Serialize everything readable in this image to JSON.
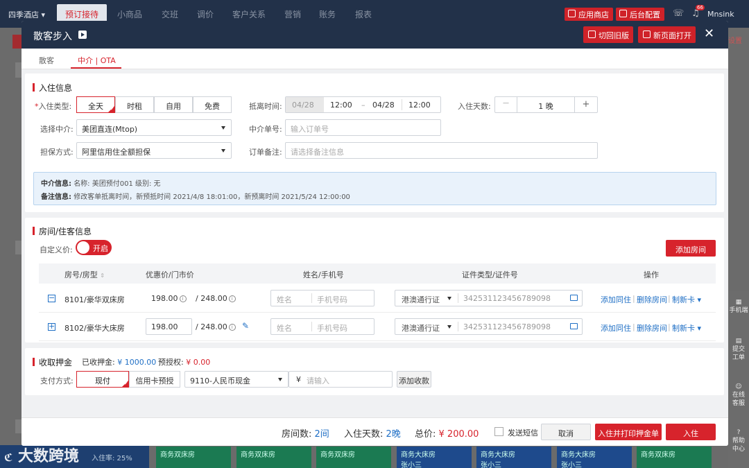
{
  "topbar": {
    "hotel": "四季酒店",
    "nav": [
      "预订接待",
      "小商品",
      "交班",
      "调价",
      "客户关系",
      "营销",
      "账务",
      "报表"
    ],
    "app_store": "应用商店",
    "admin": "后台配置",
    "badge": "66",
    "user": "Mnsink"
  },
  "background": {
    "settings": "设置",
    "occupancy": "入住率: 25%",
    "tiles": [
      "商务双床房",
      "商务双床房",
      "商务双床房",
      "商务大床房",
      "商务大床房",
      "商务大床房",
      "商务双床房"
    ],
    "tile_guests": [
      "",
      "",
      "",
      "张小三",
      "张小三",
      "张小三",
      ""
    ],
    "sidebar": [
      "手机端",
      "提交工单",
      "在线客服",
      "帮助中心"
    ]
  },
  "modal": {
    "title": "散客步入",
    "btn_old": "切回旧版",
    "btn_newpage": "新页面打开",
    "close": "✕",
    "tabs": [
      "散客",
      "中介 | OTA"
    ],
    "checkin": {
      "section": "入住信息",
      "type_label": "入住类型:",
      "types": [
        "全天",
        "时租",
        "自用",
        "免费"
      ],
      "time_label": "抵离时间:",
      "arrive_date": "04/28",
      "arrive_time": "12:00",
      "dash": "–",
      "leave_date": "04/28",
      "leave_time": "12:00",
      "days_label": "入住天数:",
      "days_minus": "—",
      "days_value": "1 晚",
      "days_plus": "+",
      "agent_label": "选择中介:",
      "agent_value": "美团直连(Mtop)",
      "order_label": "中介单号:",
      "order_placeholder": "输入订单号",
      "guarantee_label": "担保方式:",
      "guarantee_value": "阿里信用住全额担保",
      "remark_label": "订单备注:",
      "remark_placeholder": "请选择备注信息",
      "info_agent_key": "中介信息:",
      "info_agent_val": "名称:  美团预付001   级别:  无",
      "info_remark_key": "备注信息:",
      "info_remark_val": "修改客单抵离时间，新预抵时间 2021/4/8 18:01:00，新预离时间 2021/5/24 12:00:00"
    },
    "rooms": {
      "section": "房间/住客信息",
      "custom_price_label": "自定义价:",
      "toggle": "开启",
      "add_room": "添加房间",
      "headers": [
        "房号/房型",
        "优惠价/门市价",
        "姓名/手机号",
        "证件类型/证件号",
        "操作"
      ],
      "rows": [
        {
          "expand": "−",
          "room": "8101/豪华双床房",
          "price": "198.00",
          "rack": "/  248.00",
          "name_ph": "姓名",
          "phone_ph": "手机号码",
          "id_type": "港澳通行证",
          "id_no": "342531123456789098",
          "act_add": "添加同住",
          "act_del": "删除房间",
          "act_card": "制新卡"
        },
        {
          "expand": "+",
          "room": "8102/豪华大床房",
          "price": "198.00",
          "rack": "/  248.00",
          "name_ph": "姓名",
          "phone_ph": "手机号码",
          "id_type": "港澳通行证",
          "id_no": "342531123456789098",
          "act_add": "添加同住",
          "act_del": "删除房间",
          "act_card": "制新卡"
        }
      ]
    },
    "deposit": {
      "section": "收取押金",
      "received_label": "已收押金:",
      "received": "¥ 1000.00",
      "preauth_label": "预授权:",
      "preauth": "¥ 0.00",
      "pay_label": "支付方式:",
      "pay_methods": [
        "现付",
        "信用卡预授"
      ],
      "currency": "9110-人民币现金",
      "yen": "¥",
      "amount_placeholder": "请输入",
      "add_btn": "添加收款"
    },
    "footer": {
      "rooms_label": "房间数:",
      "rooms": "2间",
      "days_label": "入住天数:",
      "days": "2晚",
      "total_label": "总价:",
      "total": "¥ 200.00",
      "sms": "发送短信",
      "cancel": "取消",
      "checkin_print": "入住并打印押金单",
      "checkin": "入住"
    }
  },
  "watermark": "大数跨境",
  "colors": {
    "accent": "#d7232c",
    "navy": "#223149",
    "link": "#1f6fc5"
  }
}
